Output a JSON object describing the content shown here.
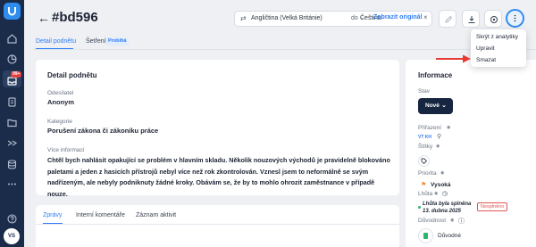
{
  "sidebar": {
    "items": [
      "home-icon",
      "chart-icon",
      "inbox-icon",
      "document-icon",
      "folder-icon",
      "flow-icon",
      "database-icon",
      "more-icon",
      "help-icon",
      "settings-icon"
    ],
    "inbox_badge": "99+",
    "avatar": "VS",
    "accent": "#2f8df0"
  },
  "header": {
    "title": "#bd596",
    "translate": {
      "source_lang": "Angličtina (Velká Británie)",
      "to": "do",
      "target_lang": "Čeština",
      "show_original": "Zobrazit originál"
    }
  },
  "tabs": {
    "detail": "Detail podnětu",
    "investigation": "Šetření",
    "investigation_badge": "Probíhá"
  },
  "detail": {
    "heading": "Detail podnětu",
    "sender_label": "Odesílatel",
    "sender_value": "Anonym",
    "category_label": "Kategorie",
    "category_value": "Porušení zákona či zákoníku práce",
    "info_label": "Více informací",
    "info_value": "Chtěl bych nahlásit opakující se problém v hlavním skladu. Několik nouzových východů je pravidelně blokováno paletami a jeden z hasicích přístrojů nebyl více než rok zkontrolován. Vznesl jsem to neformálně se svým nadřízeným, ale nebyly podniknuty žádné kroky. Obávám se, že by to mohlo ohrozit zaměstnance v případě nouze."
  },
  "bottom_tabs": {
    "messages": "Zprávy",
    "internal_comments": "Interní komentáře",
    "activity_log": "Záznam aktivit"
  },
  "info_panel": {
    "heading": "Informace",
    "status_label": "Stav",
    "status_value": "Nové",
    "assignment_label": "Přiřazení",
    "assignee_initials": "VT KH",
    "tags_label": "Štítky",
    "priority_label": "Priorita",
    "priority_value": "Vysoká",
    "deadline_label": "Lhůta",
    "deadline_value_line1": "Lhůta byla splněna",
    "deadline_value_line2": "13. dubna 2025",
    "deadline_badge": "Nesplněno",
    "confidentiality_label": "Důvodnost",
    "confidentiality_value": "Důvodné"
  },
  "menu": {
    "hide_from_analytics": "Skrýt z analytiky",
    "edit": "Upravit",
    "delete": "Smazat"
  },
  "colors": {
    "accent": "#2f7cf6",
    "sidebar": "#1b2c4a",
    "status_button": "#172640",
    "danger": "#e05555",
    "arrow": "#e53935"
  }
}
